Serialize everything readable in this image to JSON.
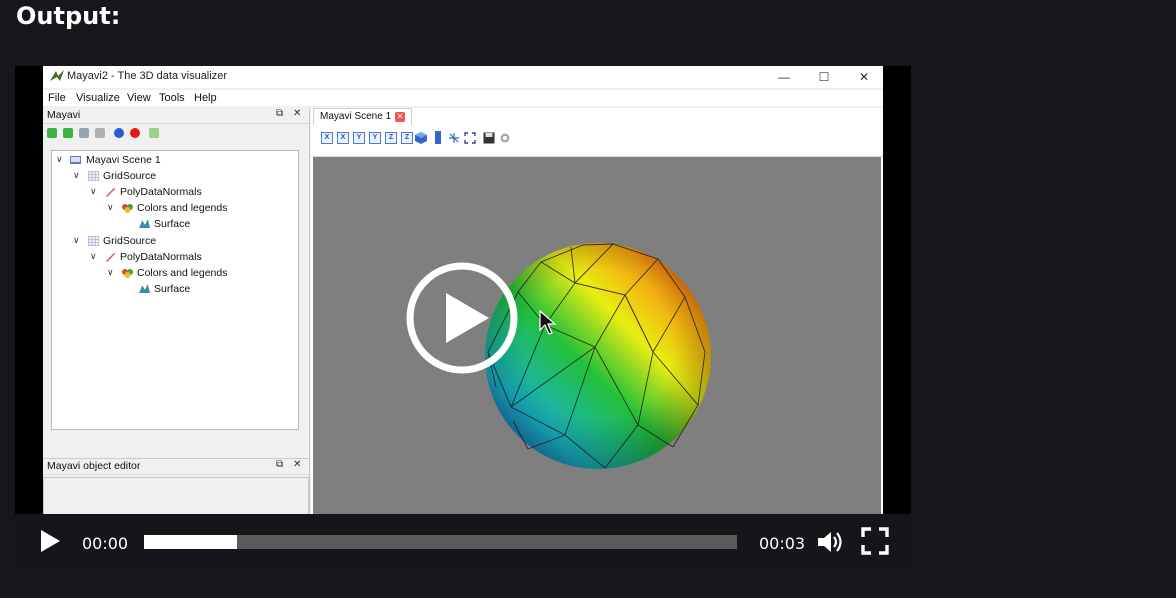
{
  "page": {
    "heading": "Output:"
  },
  "app": {
    "window_title": "Mayavi2 - The 3D data visualizer",
    "window_controls": {
      "minimize": "—",
      "maximize": "☐",
      "close": "✕"
    },
    "menu": [
      "File",
      "Visualize",
      "View",
      "Tools",
      "Help"
    ],
    "left_panel": {
      "title": "Mayavi",
      "tree": [
        {
          "label": "Mayavi Scene 1",
          "icon": "scene-icon",
          "expanded": true
        },
        {
          "label": "GridSource",
          "icon": "grid-icon",
          "expanded": true
        },
        {
          "label": "PolyDataNormals",
          "icon": "filter-icon",
          "expanded": true
        },
        {
          "label": "Colors and legends",
          "icon": "colors-icon",
          "expanded": true
        },
        {
          "label": "Surface",
          "icon": "surface-icon"
        },
        {
          "label": "GridSource",
          "icon": "grid-icon",
          "expanded": true
        },
        {
          "label": "PolyDataNormals",
          "icon": "filter-icon",
          "expanded": true
        },
        {
          "label": "Colors and legends",
          "icon": "colors-icon",
          "expanded": true
        },
        {
          "label": "Surface",
          "icon": "surface-icon"
        }
      ]
    },
    "editor_panel": {
      "title": "Mayavi object editor"
    },
    "scene_tab": {
      "label": "Mayavi Scene 1"
    },
    "view_buttons": [
      "X",
      "X",
      "Y",
      "Y",
      "Z",
      "Z"
    ],
    "colors": {
      "viewport": "#7f7f7f"
    }
  },
  "player": {
    "current_time": "00:00",
    "duration": "00:03",
    "progress_fraction": 0.157
  }
}
